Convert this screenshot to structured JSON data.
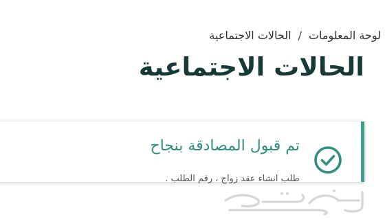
{
  "breadcrumb": {
    "items": [
      "لوحة المعلومات",
      "الحالات الاجتماعية"
    ],
    "separator": "/"
  },
  "page": {
    "title": "الحالات الاجتماعية"
  },
  "alert": {
    "title": "تم قبول المصادقة بنجاح",
    "message": "طلب انشاء عقد زواج ، رقم الطلب .",
    "icon": "check-circle-icon",
    "accent_color": "#3e9f8e"
  },
  "watermark": {
    "text": "حراج"
  }
}
